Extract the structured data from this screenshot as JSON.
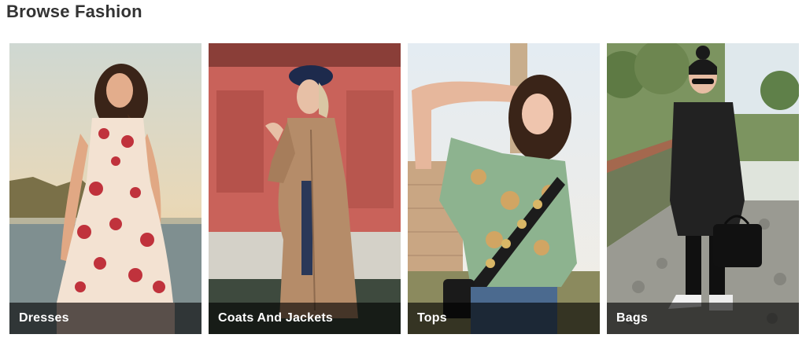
{
  "section": {
    "title": "Browse Fashion"
  },
  "categories": [
    {
      "label": "Dresses",
      "image": "woman-in-floral-dress-by-sea"
    },
    {
      "label": "Coats And Jackets",
      "image": "woman-in-beige-trench-coat-and-cap"
    },
    {
      "label": "Tops",
      "image": "woman-in-patterned-shirt-with-belt-bag"
    },
    {
      "label": "Bags",
      "image": "woman-in-leather-coat-with-black-handbag"
    }
  ],
  "colors": {
    "title": "#333333",
    "caption_overlay": "rgba(0,0,0,0.62)",
    "caption_text": "#ffffff"
  }
}
